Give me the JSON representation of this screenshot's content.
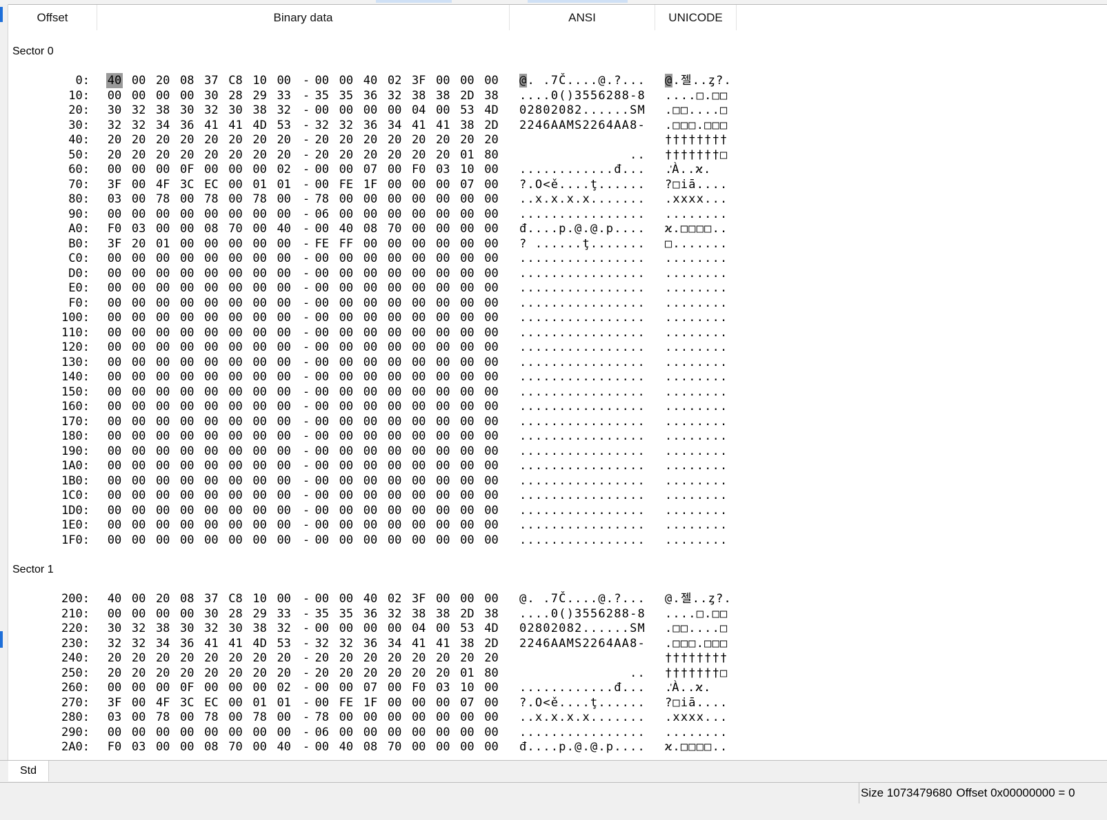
{
  "header": {
    "offset_label": "Offset",
    "binary_label": "Binary data",
    "ansi_label": "ANSI",
    "unicode_label": "UNICODE"
  },
  "sectors": [
    {
      "title": "Sector 0",
      "rows": [
        {
          "offset": "0:",
          "bytes": [
            "40",
            "00",
            "20",
            "08",
            "37",
            "C8",
            "10",
            "00",
            "00",
            "00",
            "40",
            "02",
            "3F",
            "00",
            "00",
            "00"
          ],
          "ansi": "@. .7Č....@.?...",
          "unicode": "@.젤..ȥ?."
        },
        {
          "offset": "10:",
          "bytes": [
            "00",
            "00",
            "00",
            "00",
            "30",
            "28",
            "29",
            "33",
            "35",
            "35",
            "36",
            "32",
            "38",
            "38",
            "2D",
            "38"
          ],
          "ansi": "....0()3556288-8",
          "unicode": "....□.□□"
        },
        {
          "offset": "20:",
          "bytes": [
            "30",
            "32",
            "38",
            "30",
            "32",
            "30",
            "38",
            "32",
            "00",
            "00",
            "00",
            "00",
            "04",
            "00",
            "53",
            "4D"
          ],
          "ansi": "02802082......SM",
          "unicode": ".□□....□"
        },
        {
          "offset": "30:",
          "bytes": [
            "32",
            "32",
            "34",
            "36",
            "41",
            "41",
            "4D",
            "53",
            "32",
            "32",
            "36",
            "34",
            "41",
            "41",
            "38",
            "2D"
          ],
          "ansi": "2246AAMS2264AA8-",
          "unicode": ".□□□.□□□"
        },
        {
          "offset": "40:",
          "bytes": [
            "20",
            "20",
            "20",
            "20",
            "20",
            "20",
            "20",
            "20",
            "20",
            "20",
            "20",
            "20",
            "20",
            "20",
            "20",
            "20"
          ],
          "ansi": "                ",
          "unicode": "††††††††"
        },
        {
          "offset": "50:",
          "bytes": [
            "20",
            "20",
            "20",
            "20",
            "20",
            "20",
            "20",
            "20",
            "20",
            "20",
            "20",
            "20",
            "20",
            "20",
            "01",
            "80"
          ],
          "ansi": "              ..",
          "unicode": "†††††††□"
        },
        {
          "offset": "60:",
          "bytes": [
            "00",
            "00",
            "00",
            "0F",
            "00",
            "00",
            "00",
            "02",
            "00",
            "00",
            "07",
            "00",
            "F0",
            "03",
            "10",
            "00"
          ],
          "ansi": "............đ...",
          "unicode": ".ᡃÀ..ϰ."
        },
        {
          "offset": "70:",
          "bytes": [
            "3F",
            "00",
            "4F",
            "3C",
            "EC",
            "00",
            "01",
            "01",
            "00",
            "FE",
            "1F",
            "00",
            "00",
            "00",
            "07",
            "00"
          ],
          "ansi": "?.O<ě....ţ......",
          "unicode": "?□iā...."
        },
        {
          "offset": "80:",
          "bytes": [
            "03",
            "00",
            "78",
            "00",
            "78",
            "00",
            "78",
            "00",
            "78",
            "00",
            "00",
            "00",
            "00",
            "00",
            "00",
            "00"
          ],
          "ansi": "..x.x.x.x.......",
          "unicode": ".xxxx..."
        },
        {
          "offset": "90:",
          "bytes": [
            "00",
            "00",
            "00",
            "00",
            "00",
            "00",
            "00",
            "00",
            "06",
            "00",
            "00",
            "00",
            "00",
            "00",
            "00",
            "00"
          ],
          "ansi": "................",
          "unicode": "........"
        },
        {
          "offset": "A0:",
          "bytes": [
            "F0",
            "03",
            "00",
            "00",
            "08",
            "70",
            "00",
            "40",
            "00",
            "40",
            "08",
            "70",
            "00",
            "00",
            "00",
            "00"
          ],
          "ansi": "đ....p.@.@.p....",
          "unicode": "ϰ.□□□□.."
        },
        {
          "offset": "B0:",
          "bytes": [
            "3F",
            "20",
            "01",
            "00",
            "00",
            "00",
            "00",
            "00",
            "FE",
            "FF",
            "00",
            "00",
            "00",
            "00",
            "00",
            "00"
          ],
          "ansi": "? ......ţ.......",
          "unicode": "□......."
        },
        {
          "offset": "C0:",
          "bytes": [
            "00",
            "00",
            "00",
            "00",
            "00",
            "00",
            "00",
            "00",
            "00",
            "00",
            "00",
            "00",
            "00",
            "00",
            "00",
            "00"
          ],
          "ansi": "................",
          "unicode": "........"
        },
        {
          "offset": "D0:",
          "bytes": [
            "00",
            "00",
            "00",
            "00",
            "00",
            "00",
            "00",
            "00",
            "00",
            "00",
            "00",
            "00",
            "00",
            "00",
            "00",
            "00"
          ],
          "ansi": "................",
          "unicode": "........"
        },
        {
          "offset": "E0:",
          "bytes": [
            "00",
            "00",
            "00",
            "00",
            "00",
            "00",
            "00",
            "00",
            "00",
            "00",
            "00",
            "00",
            "00",
            "00",
            "00",
            "00"
          ],
          "ansi": "................",
          "unicode": "........"
        },
        {
          "offset": "F0:",
          "bytes": [
            "00",
            "00",
            "00",
            "00",
            "00",
            "00",
            "00",
            "00",
            "00",
            "00",
            "00",
            "00",
            "00",
            "00",
            "00",
            "00"
          ],
          "ansi": "................",
          "unicode": "........"
        },
        {
          "offset": "100:",
          "bytes": [
            "00",
            "00",
            "00",
            "00",
            "00",
            "00",
            "00",
            "00",
            "00",
            "00",
            "00",
            "00",
            "00",
            "00",
            "00",
            "00"
          ],
          "ansi": "................",
          "unicode": "........"
        },
        {
          "offset": "110:",
          "bytes": [
            "00",
            "00",
            "00",
            "00",
            "00",
            "00",
            "00",
            "00",
            "00",
            "00",
            "00",
            "00",
            "00",
            "00",
            "00",
            "00"
          ],
          "ansi": "................",
          "unicode": "........"
        },
        {
          "offset": "120:",
          "bytes": [
            "00",
            "00",
            "00",
            "00",
            "00",
            "00",
            "00",
            "00",
            "00",
            "00",
            "00",
            "00",
            "00",
            "00",
            "00",
            "00"
          ],
          "ansi": "................",
          "unicode": "........"
        },
        {
          "offset": "130:",
          "bytes": [
            "00",
            "00",
            "00",
            "00",
            "00",
            "00",
            "00",
            "00",
            "00",
            "00",
            "00",
            "00",
            "00",
            "00",
            "00",
            "00"
          ],
          "ansi": "................",
          "unicode": "........"
        },
        {
          "offset": "140:",
          "bytes": [
            "00",
            "00",
            "00",
            "00",
            "00",
            "00",
            "00",
            "00",
            "00",
            "00",
            "00",
            "00",
            "00",
            "00",
            "00",
            "00"
          ],
          "ansi": "................",
          "unicode": "........"
        },
        {
          "offset": "150:",
          "bytes": [
            "00",
            "00",
            "00",
            "00",
            "00",
            "00",
            "00",
            "00",
            "00",
            "00",
            "00",
            "00",
            "00",
            "00",
            "00",
            "00"
          ],
          "ansi": "................",
          "unicode": "........"
        },
        {
          "offset": "160:",
          "bytes": [
            "00",
            "00",
            "00",
            "00",
            "00",
            "00",
            "00",
            "00",
            "00",
            "00",
            "00",
            "00",
            "00",
            "00",
            "00",
            "00"
          ],
          "ansi": "................",
          "unicode": "........"
        },
        {
          "offset": "170:",
          "bytes": [
            "00",
            "00",
            "00",
            "00",
            "00",
            "00",
            "00",
            "00",
            "00",
            "00",
            "00",
            "00",
            "00",
            "00",
            "00",
            "00"
          ],
          "ansi": "................",
          "unicode": "........"
        },
        {
          "offset": "180:",
          "bytes": [
            "00",
            "00",
            "00",
            "00",
            "00",
            "00",
            "00",
            "00",
            "00",
            "00",
            "00",
            "00",
            "00",
            "00",
            "00",
            "00"
          ],
          "ansi": "................",
          "unicode": "........"
        },
        {
          "offset": "190:",
          "bytes": [
            "00",
            "00",
            "00",
            "00",
            "00",
            "00",
            "00",
            "00",
            "00",
            "00",
            "00",
            "00",
            "00",
            "00",
            "00",
            "00"
          ],
          "ansi": "................",
          "unicode": "........"
        },
        {
          "offset": "1A0:",
          "bytes": [
            "00",
            "00",
            "00",
            "00",
            "00",
            "00",
            "00",
            "00",
            "00",
            "00",
            "00",
            "00",
            "00",
            "00",
            "00",
            "00"
          ],
          "ansi": "................",
          "unicode": "........"
        },
        {
          "offset": "1B0:",
          "bytes": [
            "00",
            "00",
            "00",
            "00",
            "00",
            "00",
            "00",
            "00",
            "00",
            "00",
            "00",
            "00",
            "00",
            "00",
            "00",
            "00"
          ],
          "ansi": "................",
          "unicode": "........"
        },
        {
          "offset": "1C0:",
          "bytes": [
            "00",
            "00",
            "00",
            "00",
            "00",
            "00",
            "00",
            "00",
            "00",
            "00",
            "00",
            "00",
            "00",
            "00",
            "00",
            "00"
          ],
          "ansi": "................",
          "unicode": "........"
        },
        {
          "offset": "1D0:",
          "bytes": [
            "00",
            "00",
            "00",
            "00",
            "00",
            "00",
            "00",
            "00",
            "00",
            "00",
            "00",
            "00",
            "00",
            "00",
            "00",
            "00"
          ],
          "ansi": "................",
          "unicode": "........"
        },
        {
          "offset": "1E0:",
          "bytes": [
            "00",
            "00",
            "00",
            "00",
            "00",
            "00",
            "00",
            "00",
            "00",
            "00",
            "00",
            "00",
            "00",
            "00",
            "00",
            "00"
          ],
          "ansi": "................",
          "unicode": "........"
        },
        {
          "offset": "1F0:",
          "bytes": [
            "00",
            "00",
            "00",
            "00",
            "00",
            "00",
            "00",
            "00",
            "00",
            "00",
            "00",
            "00",
            "00",
            "00",
            "00",
            "00"
          ],
          "ansi": "................",
          "unicode": "........"
        }
      ]
    },
    {
      "title": "Sector 1",
      "rows": [
        {
          "offset": "200:",
          "bytes": [
            "40",
            "00",
            "20",
            "08",
            "37",
            "C8",
            "10",
            "00",
            "00",
            "00",
            "40",
            "02",
            "3F",
            "00",
            "00",
            "00"
          ],
          "ansi": "@. .7Č....@.?...",
          "unicode": "@.젤..ȥ?."
        },
        {
          "offset": "210:",
          "bytes": [
            "00",
            "00",
            "00",
            "00",
            "30",
            "28",
            "29",
            "33",
            "35",
            "35",
            "36",
            "32",
            "38",
            "38",
            "2D",
            "38"
          ],
          "ansi": "....0()3556288-8",
          "unicode": "....□.□□"
        },
        {
          "offset": "220:",
          "bytes": [
            "30",
            "32",
            "38",
            "30",
            "32",
            "30",
            "38",
            "32",
            "00",
            "00",
            "00",
            "00",
            "04",
            "00",
            "53",
            "4D"
          ],
          "ansi": "02802082......SM",
          "unicode": ".□□....□"
        },
        {
          "offset": "230:",
          "bytes": [
            "32",
            "32",
            "34",
            "36",
            "41",
            "41",
            "4D",
            "53",
            "32",
            "32",
            "36",
            "34",
            "41",
            "41",
            "38",
            "2D"
          ],
          "ansi": "2246AAMS2264AA8-",
          "unicode": ".□□□.□□□"
        },
        {
          "offset": "240:",
          "bytes": [
            "20",
            "20",
            "20",
            "20",
            "20",
            "20",
            "20",
            "20",
            "20",
            "20",
            "20",
            "20",
            "20",
            "20",
            "20",
            "20"
          ],
          "ansi": "                ",
          "unicode": "††††††††"
        },
        {
          "offset": "250:",
          "bytes": [
            "20",
            "20",
            "20",
            "20",
            "20",
            "20",
            "20",
            "20",
            "20",
            "20",
            "20",
            "20",
            "20",
            "20",
            "01",
            "80"
          ],
          "ansi": "              ..",
          "unicode": "†††††††□"
        },
        {
          "offset": "260:",
          "bytes": [
            "00",
            "00",
            "00",
            "0F",
            "00",
            "00",
            "00",
            "02",
            "00",
            "00",
            "07",
            "00",
            "F0",
            "03",
            "10",
            "00"
          ],
          "ansi": "............đ...",
          "unicode": ".ᡃÀ..ϰ."
        },
        {
          "offset": "270:",
          "bytes": [
            "3F",
            "00",
            "4F",
            "3C",
            "EC",
            "00",
            "01",
            "01",
            "00",
            "FE",
            "1F",
            "00",
            "00",
            "00",
            "07",
            "00"
          ],
          "ansi": "?.O<ě....ţ......",
          "unicode": "?□iā...."
        },
        {
          "offset": "280:",
          "bytes": [
            "03",
            "00",
            "78",
            "00",
            "78",
            "00",
            "78",
            "00",
            "78",
            "00",
            "00",
            "00",
            "00",
            "00",
            "00",
            "00"
          ],
          "ansi": "..x.x.x.x.......",
          "unicode": ".xxxx..."
        },
        {
          "offset": "290:",
          "bytes": [
            "00",
            "00",
            "00",
            "00",
            "00",
            "00",
            "00",
            "00",
            "06",
            "00",
            "00",
            "00",
            "00",
            "00",
            "00",
            "00"
          ],
          "ansi": "................",
          "unicode": "........"
        },
        {
          "offset": "2A0:",
          "bytes": [
            "F0",
            "03",
            "00",
            "00",
            "08",
            "70",
            "00",
            "40",
            "00",
            "40",
            "08",
            "70",
            "00",
            "00",
            "00",
            "00"
          ],
          "ansi": "đ....p.@.@.p....",
          "unicode": "ϰ.□□□□.."
        }
      ]
    }
  ],
  "separator": "-",
  "tabs": {
    "std_label": "Std"
  },
  "status": {
    "size": "Size 1073479680",
    "offset": "Offset 0x00000000 = 0"
  },
  "colors": {
    "selection": "#9a9a9a",
    "accent": "#1e6fd9"
  }
}
